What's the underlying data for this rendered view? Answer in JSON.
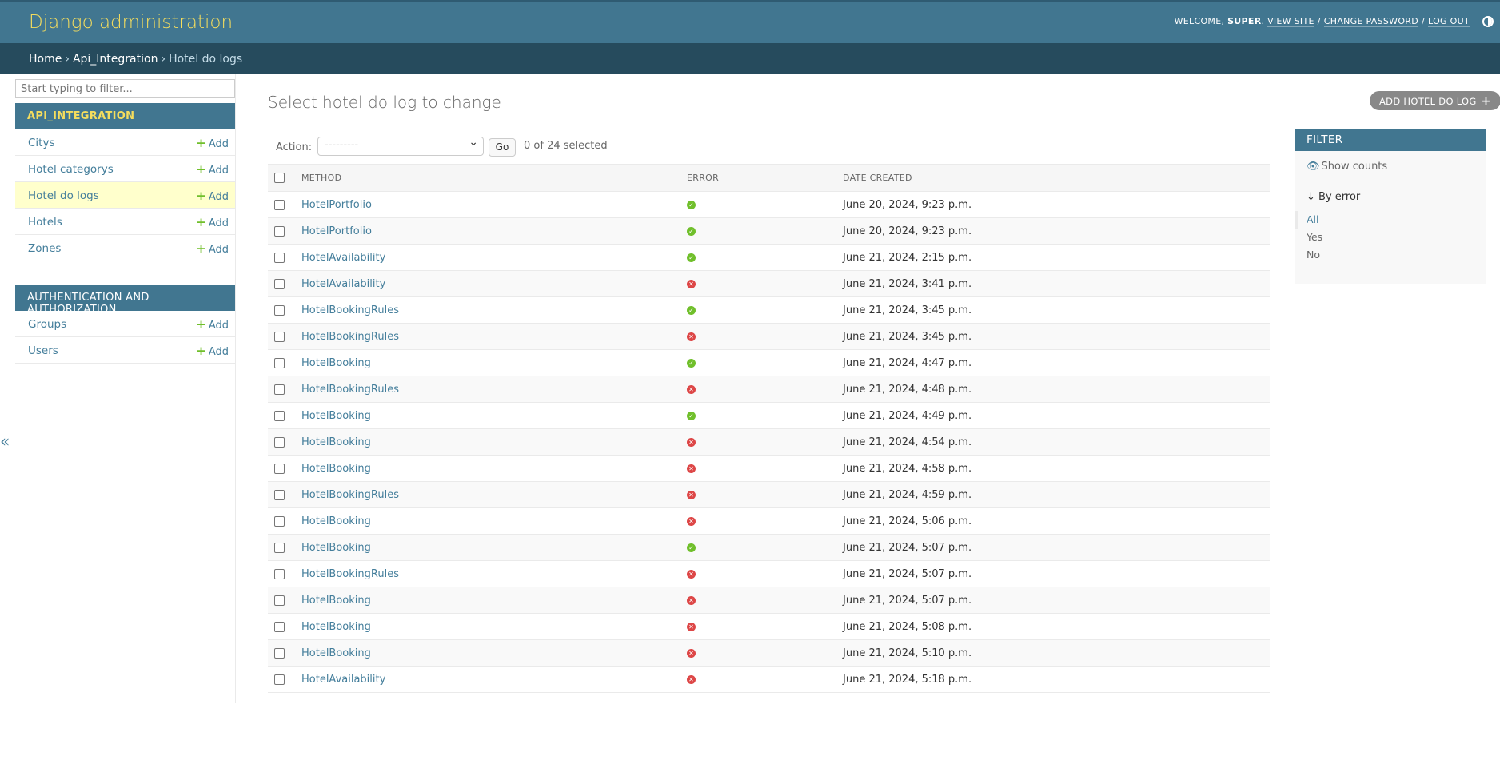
{
  "header": {
    "branding": "Django administration",
    "welcome": "WELCOME,",
    "username": "SUPER",
    "view_site": "VIEW SITE",
    "change_password": "CHANGE PASSWORD",
    "log_out": "LOG OUT"
  },
  "breadcrumbs": {
    "home": "Home",
    "app": "Api_Integration",
    "current": "Hotel do logs"
  },
  "sidebar": {
    "filter_placeholder": "Start typing to filter...",
    "modules": [
      {
        "caption": "API_INTEGRATION",
        "models": [
          {
            "label": "Citys",
            "add": "Add"
          },
          {
            "label": "Hotel categorys",
            "add": "Add"
          },
          {
            "label": "Hotel do logs",
            "add": "Add"
          },
          {
            "label": "Hotels",
            "add": "Add"
          },
          {
            "label": "Zones",
            "add": "Add"
          }
        ]
      },
      {
        "caption": "AUTHENTICATION AND AUTHORIZATION",
        "models": [
          {
            "label": "Groups",
            "add": "Add"
          },
          {
            "label": "Users",
            "add": "Add"
          }
        ]
      }
    ],
    "collapse_glyph": "«"
  },
  "main": {
    "title": "Select hotel do log to change",
    "add_button": "ADD HOTEL DO LOG",
    "action_label": "Action:",
    "action_selected": "---------",
    "go_label": "Go",
    "selection_count": "0 of 24 selected",
    "columns": [
      "METHOD",
      "ERROR",
      "DATE CREATED"
    ],
    "rows": [
      {
        "method": "HotelPortfolio",
        "error": false,
        "date": "June 20, 2024, 9:23 p.m."
      },
      {
        "method": "HotelPortfolio",
        "error": false,
        "date": "June 20, 2024, 9:23 p.m."
      },
      {
        "method": "HotelAvailability",
        "error": false,
        "date": "June 21, 2024, 2:15 p.m."
      },
      {
        "method": "HotelAvailability",
        "error": true,
        "date": "June 21, 2024, 3:41 p.m."
      },
      {
        "method": "HotelBookingRules",
        "error": false,
        "date": "June 21, 2024, 3:45 p.m."
      },
      {
        "method": "HotelBookingRules",
        "error": true,
        "date": "June 21, 2024, 3:45 p.m."
      },
      {
        "method": "HotelBooking",
        "error": false,
        "date": "June 21, 2024, 4:47 p.m."
      },
      {
        "method": "HotelBookingRules",
        "error": true,
        "date": "June 21, 2024, 4:48 p.m."
      },
      {
        "method": "HotelBooking",
        "error": false,
        "date": "June 21, 2024, 4:49 p.m."
      },
      {
        "method": "HotelBooking",
        "error": true,
        "date": "June 21, 2024, 4:54 p.m."
      },
      {
        "method": "HotelBooking",
        "error": true,
        "date": "June 21, 2024, 4:58 p.m."
      },
      {
        "method": "HotelBookingRules",
        "error": true,
        "date": "June 21, 2024, 4:59 p.m."
      },
      {
        "method": "HotelBooking",
        "error": true,
        "date": "June 21, 2024, 5:06 p.m."
      },
      {
        "method": "HotelBooking",
        "error": false,
        "date": "June 21, 2024, 5:07 p.m."
      },
      {
        "method": "HotelBookingRules",
        "error": true,
        "date": "June 21, 2024, 5:07 p.m."
      },
      {
        "method": "HotelBooking",
        "error": true,
        "date": "June 21, 2024, 5:07 p.m."
      },
      {
        "method": "HotelBooking",
        "error": true,
        "date": "June 21, 2024, 5:08 p.m."
      },
      {
        "method": "HotelBooking",
        "error": true,
        "date": "June 21, 2024, 5:10 p.m."
      },
      {
        "method": "HotelAvailability",
        "error": true,
        "date": "June 21, 2024, 5:18 p.m."
      }
    ]
  },
  "filter": {
    "title": "FILTER",
    "show_counts": "Show counts",
    "heading": "↓ By error",
    "options": [
      "All",
      "Yes",
      "No"
    ],
    "selected": "All"
  },
  "colors": {
    "header_bg": "#417690",
    "breadcrumb_bg": "#264b5d",
    "brand_text": "#f5dd5d",
    "link": "#447e9b",
    "ok": "#70bf2b",
    "error": "#dd4646",
    "current_model_bg": "#ffffcc"
  },
  "icons": {
    "ok": "check-circle-icon",
    "error": "x-circle-icon",
    "add": "plus-icon",
    "theme": "half-circle-icon",
    "show_counts": "eye-icon"
  }
}
